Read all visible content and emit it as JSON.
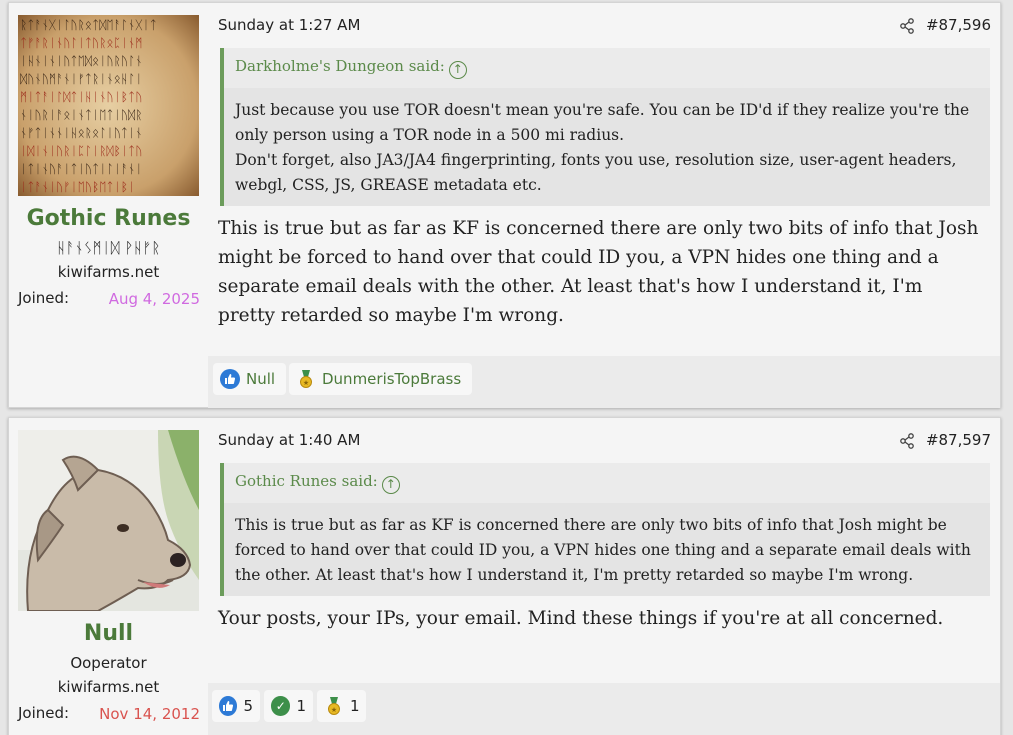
{
  "posts": [
    {
      "username": "Gothic Runes",
      "user_title": "ᚺᚨᚾᛊᛗᛁᛞ ᚹᚺᚠᚱ",
      "site": "kiwifarms.net",
      "joined_label": "Joined:",
      "joined_date": "Aug 4, 2025",
      "joined_color": "#d06ae0",
      "timestamp": "Sunday at 1:27 AM",
      "post_number": "#87,596",
      "quote": {
        "author": "Darkholme's Dungeon said:",
        "text_1": "Just because you use TOR doesn't mean you're safe. You can be ID'd if they realize you're the only person using a TOR node in a 500 mi radius.",
        "text_2": "Don't forget, also JA3/JA4 fingerprinting, fonts you use, resolution size, user-agent headers, webgl, CSS, JS, GREASE metadata etc."
      },
      "body": "This is true but as far as KF is concerned there are only two bits of info that Josh might be forced to hand over that could ID you, a VPN hides one thing and a separate email deals with the other. At least that's how I understand it, I'm pretty retarded so maybe I'm wrong.",
      "reactions": [
        {
          "icon": "like-icon",
          "label": "Null"
        },
        {
          "icon": "medal-icon",
          "label": "DunmerisTopBrass"
        }
      ]
    },
    {
      "username": "Null",
      "user_title": "Ooperator",
      "site": "kiwifarms.net",
      "joined_label": "Joined:",
      "joined_date": "Nov 14, 2012",
      "joined_color": "#d9534f",
      "timestamp": "Sunday at 1:40 AM",
      "post_number": "#87,597",
      "quote": {
        "author": "Gothic Runes said:",
        "text_1": "This is true but as far as KF is concerned there are only two bits of info that Josh might be forced to hand over that could ID you, a VPN hides one thing and a separate email deals with the other. At least that's how I understand it, I'm pretty retarded so maybe I'm wrong."
      },
      "body": "Your posts, your IPs, your email. Mind these things if you're at all concerned.",
      "reactions": [
        {
          "icon": "like-icon",
          "count": "5"
        },
        {
          "icon": "check-icon",
          "count": "1"
        },
        {
          "icon": "medal-icon",
          "count": "1"
        }
      ]
    }
  ],
  "colors": {
    "username": "#4b7a3a",
    "quote_border": "#6c9c5b"
  }
}
